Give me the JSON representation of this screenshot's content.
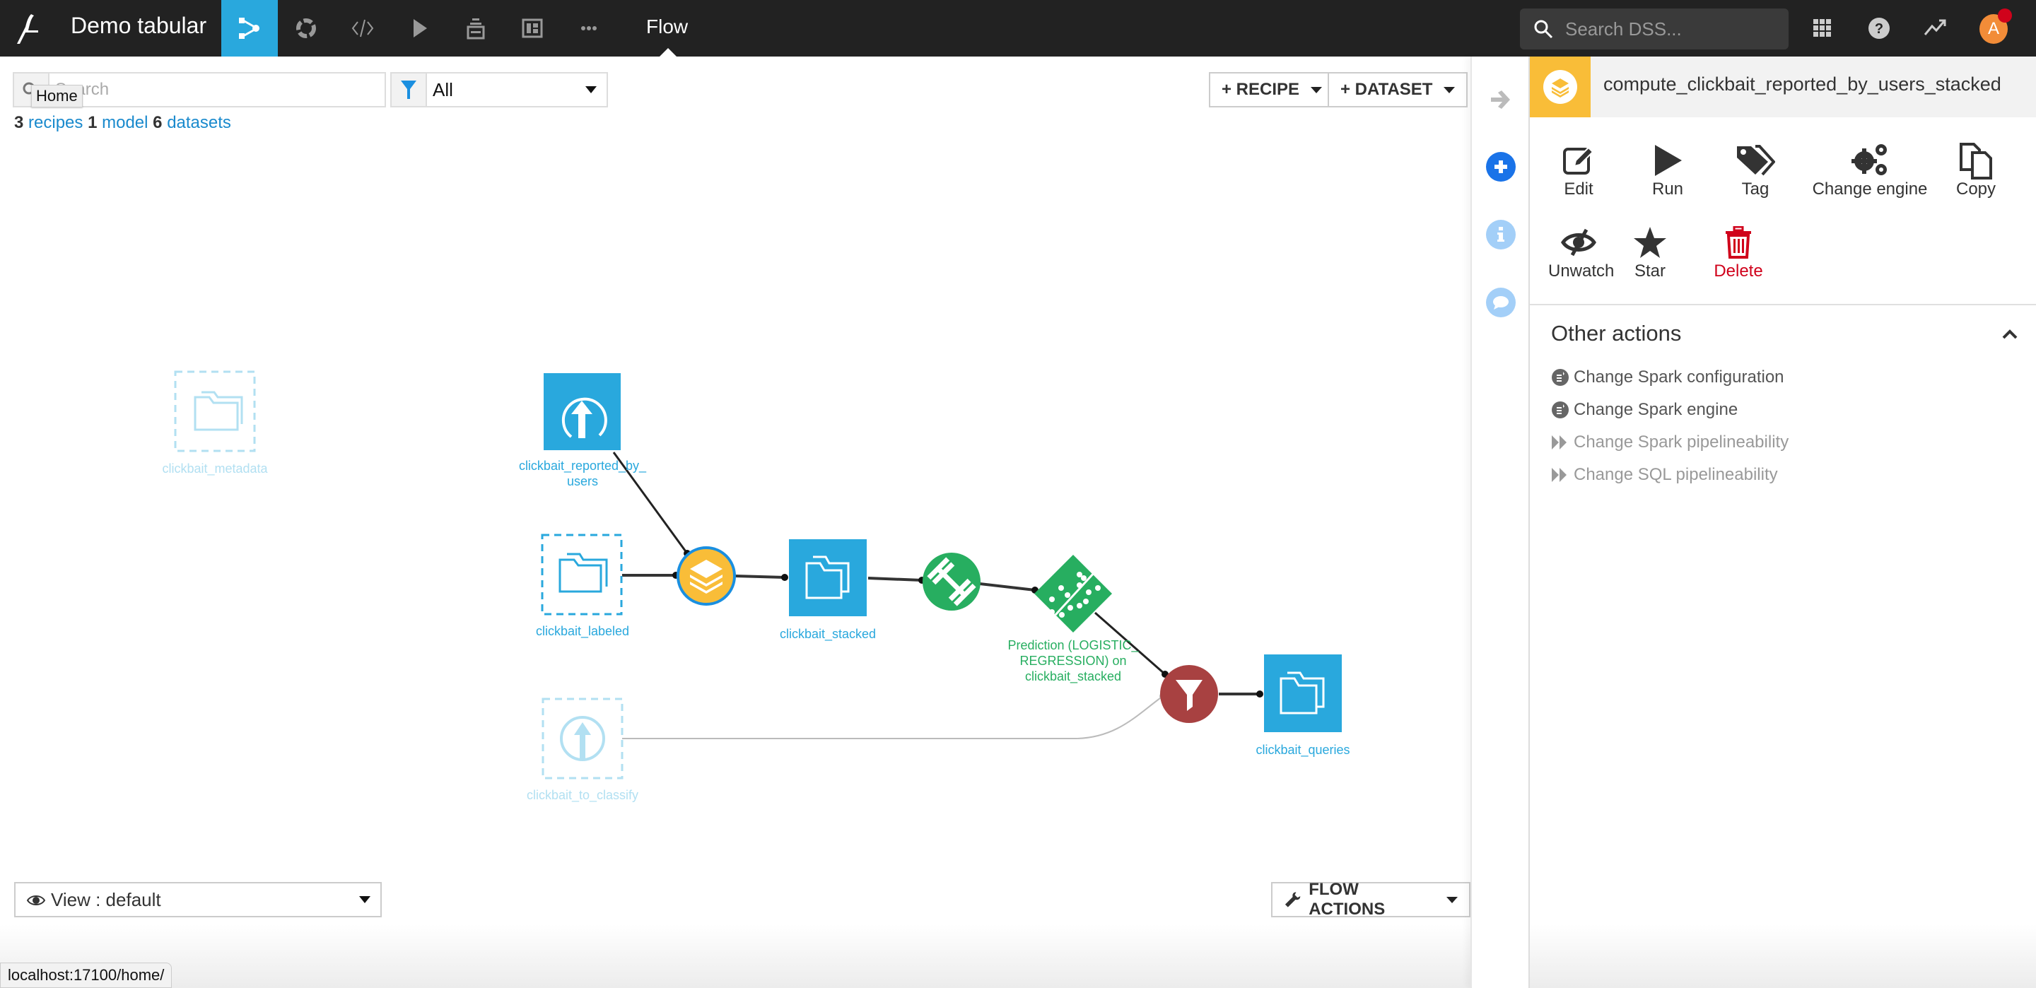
{
  "topbar": {
    "project_title": "Demo tabular",
    "nav_icons": [
      "flow-icon",
      "lab-icon",
      "code-icon",
      "run-icon",
      "jobs-icon",
      "dashboard-icon",
      "more-icon"
    ],
    "section_label": "Flow",
    "global_search_placeholder": "Search DSS...",
    "avatar_initial": "A",
    "accent_color": "#29a8dd"
  },
  "flow": {
    "search_placeholder": "Search",
    "tooltip": "Home",
    "filter_value": "All",
    "counts": {
      "recipes_count": "3",
      "recipes_label": "recipes",
      "model_count": "1",
      "model_label": "model",
      "datasets_count": "6",
      "datasets_label": "datasets"
    },
    "recipe_button": "+ RECIPE",
    "dataset_button": "+ DATASET",
    "view_label": "View : default",
    "flow_actions_button": "FLOW ACTIONS",
    "status_url": "localhost:17100/home/",
    "nodes": {
      "metadata": "clickbait_metadata",
      "reported_line1": "clickbait_reported_by_",
      "reported_line2": "users",
      "labeled": "clickbait_labeled",
      "stacked": "clickbait_stacked",
      "model_line1": "Prediction (LOGISTIC_",
      "model_line2": "REGRESSION) on",
      "model_line3": "clickbait_stacked",
      "to_classify": "clickbait_to_classify",
      "queries": "clickbait_queries"
    }
  },
  "panel": {
    "title": "compute_clickbait_reported_by_users_stacked",
    "header_color": "#f9bd38",
    "actions": [
      {
        "label": "Edit",
        "icon": "edit-icon"
      },
      {
        "label": "Run",
        "icon": "run-icon"
      },
      {
        "label": "Tag",
        "icon": "tag-icon"
      },
      {
        "label": "Change engine",
        "icon": "gears-icon"
      },
      {
        "label": "Copy",
        "icon": "copy-icon"
      },
      {
        "label": "Unwatch",
        "icon": "eye-slash-icon"
      },
      {
        "label": "Star",
        "icon": "star-icon"
      },
      {
        "label": "Delete",
        "icon": "trash-icon"
      }
    ],
    "other_actions_title": "Other actions",
    "other_actions": [
      {
        "label": "Change Spark configuration",
        "enabled": true
      },
      {
        "label": "Change Spark engine",
        "enabled": true
      },
      {
        "label": "Change Spark pipelineability",
        "enabled": false
      },
      {
        "label": "Change SQL pipelineability",
        "enabled": false
      }
    ]
  }
}
